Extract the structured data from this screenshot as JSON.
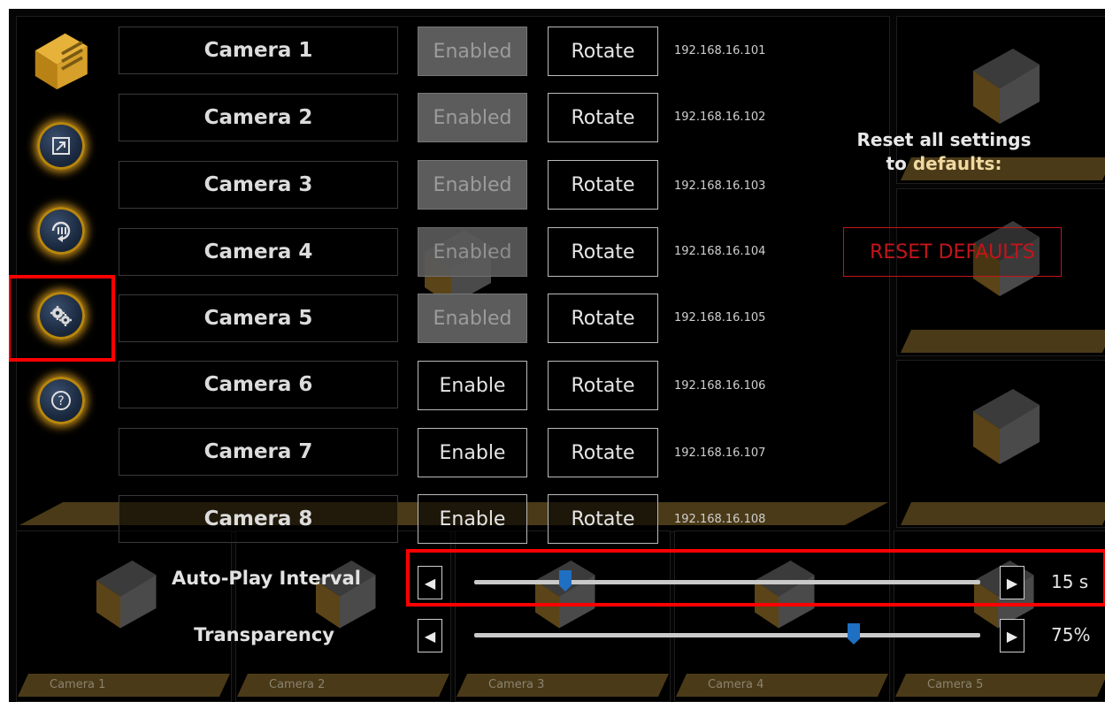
{
  "cameras": [
    {
      "name": "Camera 1",
      "state": "Enabled",
      "rotate": "Rotate",
      "ip": "192.168.16.101"
    },
    {
      "name": "Camera 2",
      "state": "Enabled",
      "rotate": "Rotate",
      "ip": "192.168.16.102"
    },
    {
      "name": "Camera 3",
      "state": "Enabled",
      "rotate": "Rotate",
      "ip": "192.168.16.103"
    },
    {
      "name": "Camera 4",
      "state": "Enabled",
      "rotate": "Rotate",
      "ip": "192.168.16.104"
    },
    {
      "name": "Camera 5",
      "state": "Enabled",
      "rotate": "Rotate",
      "ip": "192.168.16.105"
    },
    {
      "name": "Camera 6",
      "state": "Enable",
      "rotate": "Rotate",
      "ip": "192.168.16.106"
    },
    {
      "name": "Camera 7",
      "state": "Enable",
      "rotate": "Rotate",
      "ip": "192.168.16.107"
    },
    {
      "name": "Camera 8",
      "state": "Enable",
      "rotate": "Rotate",
      "ip": "192.168.16.108"
    }
  ],
  "sidebar": {
    "icons": [
      "app-logo-icon",
      "fullscreen-icon",
      "autoplay-icon",
      "settings-gears-icon",
      "help-icon"
    ]
  },
  "reset": {
    "title_line1": "Reset all settings",
    "title_line2_prefix": "to ",
    "title_line2_emph": "defaults:",
    "button": "RESET DEFAULTS"
  },
  "sliders": {
    "autoplay": {
      "label": "Auto-Play Interval",
      "value": "15 s",
      "fraction": 0.18
    },
    "transparency": {
      "label": "Transparency",
      "value": "75%",
      "fraction": 0.75
    }
  },
  "thumbnails": [
    "Camera 1",
    "Camera 2",
    "Camera 3",
    "Camera 4",
    "Camera 5"
  ],
  "colors": {
    "accent_gold": "#c48c1a",
    "reset_red": "#c2151b",
    "slider_thumb": "#1f6fc2",
    "highlight_red": "#ff0000"
  }
}
